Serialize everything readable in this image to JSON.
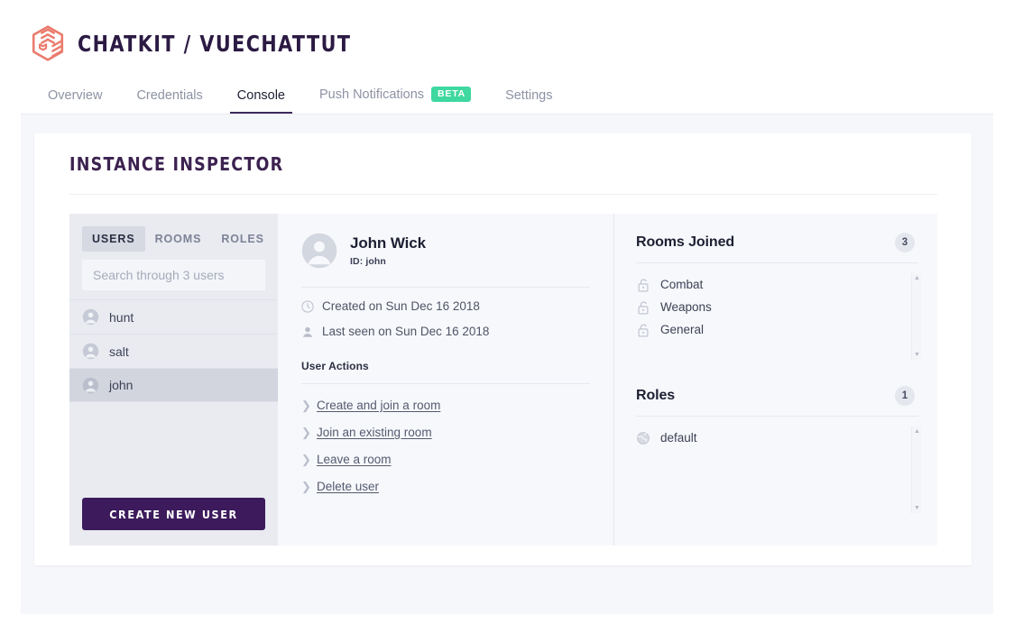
{
  "header": {
    "brand_title": "CHATKIT / VUECHATTUT",
    "logo_icon": "cube-logo-icon",
    "nav": [
      {
        "label": "Overview",
        "active": false,
        "badge": null
      },
      {
        "label": "Credentials",
        "active": false,
        "badge": null
      },
      {
        "label": "Console",
        "active": true,
        "badge": null
      },
      {
        "label": "Push Notifications",
        "active": false,
        "badge": "BETA"
      },
      {
        "label": "Settings",
        "active": false,
        "badge": null
      }
    ]
  },
  "card": {
    "title": "INSTANCE INSPECTOR"
  },
  "sidebar": {
    "tabs": [
      {
        "label": "USERS",
        "active": true
      },
      {
        "label": "ROOMS",
        "active": false
      },
      {
        "label": "ROLES",
        "active": false
      }
    ],
    "search": {
      "placeholder": "Search through 3 users",
      "value": ""
    },
    "users": [
      {
        "name": "hunt",
        "selected": false
      },
      {
        "name": "salt",
        "selected": false
      },
      {
        "name": "john",
        "selected": true
      }
    ],
    "create_button": "CREATE NEW USER"
  },
  "detail": {
    "avatar_icon": "user-avatar-icon",
    "name": "John Wick",
    "id_label": "ID: john",
    "meta": [
      {
        "icon": "clock-icon",
        "text": "Created on Sun Dec 16 2018"
      },
      {
        "icon": "person-icon",
        "text": "Last seen on Sun Dec 16 2018"
      }
    ],
    "actions_title": "User Actions",
    "actions": [
      "Create and join a room",
      "Join an existing room",
      "Leave a room",
      "Delete user"
    ]
  },
  "rooms_section": {
    "title": "Rooms Joined",
    "count": "3",
    "items": [
      {
        "icon": "unlock-icon",
        "label": "Combat"
      },
      {
        "icon": "unlock-icon",
        "label": "Weapons"
      },
      {
        "icon": "unlock-icon",
        "label": "General"
      }
    ]
  },
  "roles_section": {
    "title": "Roles",
    "count": "1",
    "items": [
      {
        "icon": "globe-icon",
        "label": "default"
      }
    ]
  },
  "colors": {
    "brand_logo": "#ea7b6d",
    "brand_text": "#2b1a43",
    "accent_purple": "#3c1a5b",
    "beta_green": "#3ed8a0",
    "page_bg": "#f6f7fa",
    "sidebar_bg": "#e9ebf1"
  }
}
